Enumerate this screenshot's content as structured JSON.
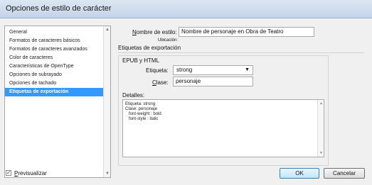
{
  "window": {
    "title": "Opciones de estilo de carácter"
  },
  "sidebar": {
    "items": [
      {
        "label": "General"
      },
      {
        "label": "Formatos de caracteres básicos"
      },
      {
        "label": "Formatos de caracteres avanzados"
      },
      {
        "label": "Color de caracteres"
      },
      {
        "label": "Características de OpenType"
      },
      {
        "label": "Opciones de subrayado"
      },
      {
        "label": "Opciones de tachado"
      },
      {
        "label": "Etiquetas de exportación",
        "selected": true
      }
    ]
  },
  "main": {
    "style_name_label_prefix": "N",
    "style_name_label_rest": "ombre de estilo:",
    "style_name_value": "Nombre de personaje en Obra de Teatro",
    "location_label": "Ubicación:",
    "section_title": "Etiquetas de exportación",
    "group_title": "EPUB y HTML",
    "tag_label": "Etiqueta:",
    "tag_value": "strong",
    "class_label_prefix": "C",
    "class_label_rest": "lase:",
    "class_value": "personaje",
    "details_label": "Detalles:",
    "details_lines": [
      "Etiqueta: strong",
      "Clase: personaje",
      "   font-weight : bold",
      "   font-style : italic"
    ]
  },
  "footer": {
    "preview_prefix": "P",
    "preview_rest": "revisualizar",
    "preview_checked": true,
    "ok_label": "OK",
    "cancel_label": "Cancelar"
  }
}
